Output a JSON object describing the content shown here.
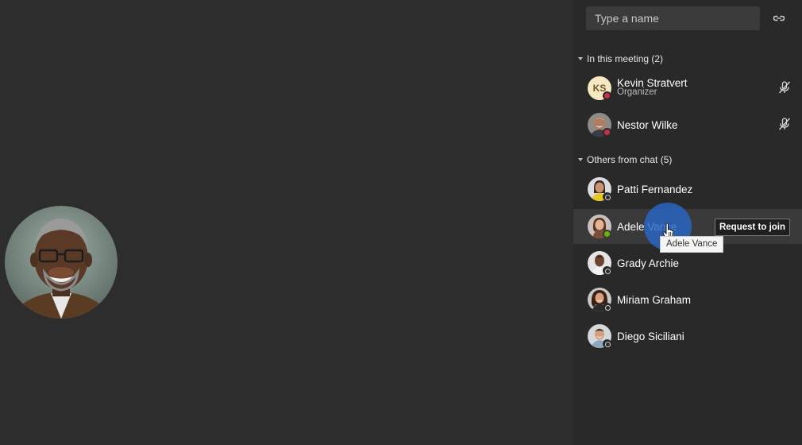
{
  "search": {
    "placeholder": "Type a name",
    "share_icon": "link-icon"
  },
  "sections": [
    {
      "label": "In this meeting (2)",
      "people": [
        {
          "initials": "KS",
          "name": "Kevin Stratvert",
          "role": "Organizer",
          "presence": "busy",
          "presence_color": "#c4314b",
          "muted": true
        },
        {
          "name": "Nestor Wilke",
          "presence": "busy",
          "presence_color": "#c4314b",
          "muted": true
        }
      ]
    },
    {
      "label": "Others from chat (5)",
      "people": [
        {
          "name": "Patti Fernandez",
          "presence": "offline"
        },
        {
          "name": "Adele Vance",
          "presence": "available",
          "presence_color": "#6bb700",
          "hovered": true,
          "action_label": "Request to join"
        },
        {
          "name": "Grady Archie",
          "presence": "offline"
        },
        {
          "name": "Miriam Graham",
          "presence": "offline"
        },
        {
          "name": "Diego Siciliani",
          "presence": "offline"
        }
      ]
    }
  ],
  "tooltip": "Adele Vance",
  "colors": {
    "stage_background": "#2d2d2d",
    "panel_background": "#292929",
    "hover_row": "#3a3a3a",
    "pointer_halo": "#2868c8"
  }
}
